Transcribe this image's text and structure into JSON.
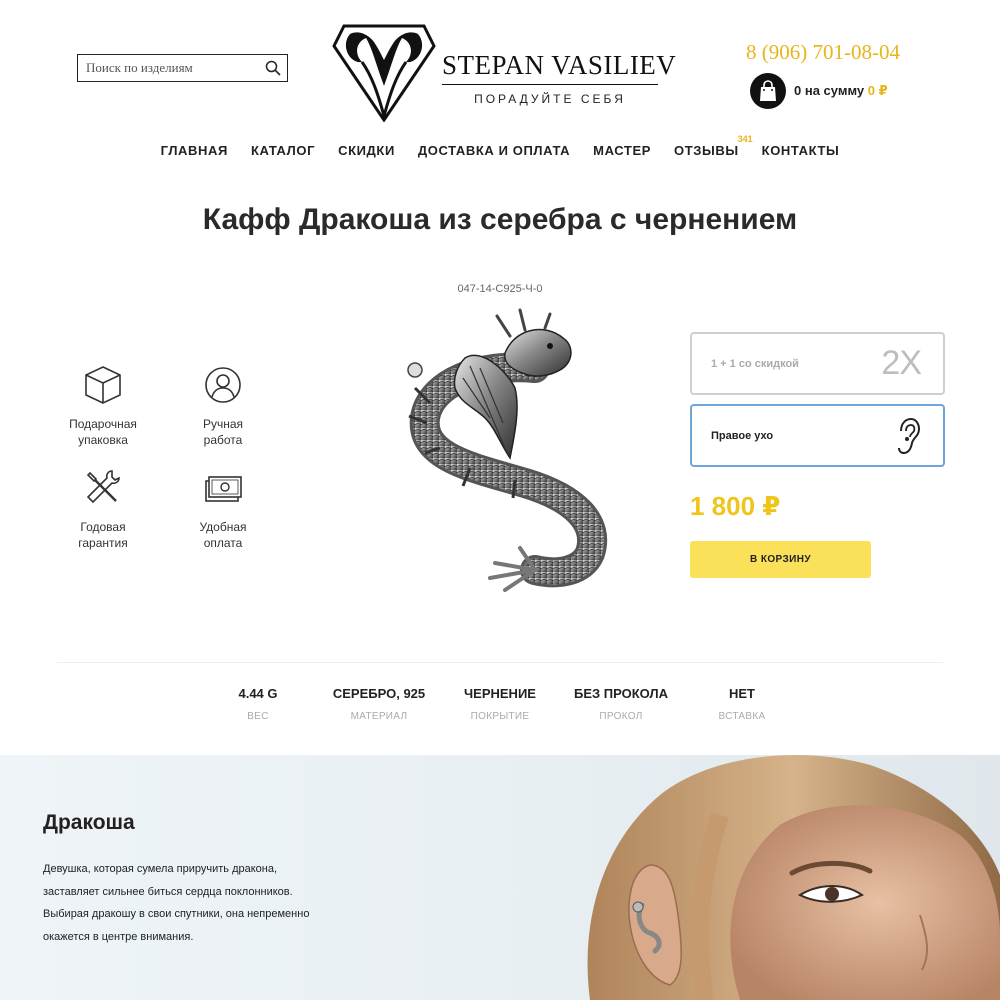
{
  "header": {
    "search_placeholder": "Поиск по изделиям",
    "brand_name": "STEPAN VASILIEV",
    "tagline": "ПОРАДУЙТЕ СЕБЯ",
    "phone": "8 (906) 701-08-04",
    "cart_count_text": "0 на сумму",
    "cart_sum": "0 ₽"
  },
  "nav": {
    "items": [
      "ГЛАВНАЯ",
      "КАТАЛОГ",
      "СКИДКИ",
      "ДОСТАВКА И ОПЛАТА",
      "МАСТЕР",
      "ОТЗЫВЫ",
      "КОНТАКТЫ"
    ],
    "reviews_badge": "341"
  },
  "product": {
    "title": "Кафф Дракоша из серебра с чернением",
    "sku": "047-14-С925-Ч-0",
    "price": "1 800 ₽",
    "buy_label": "В КОРЗИНУ",
    "options": [
      {
        "label": "1 + 1 со скидкой",
        "mark": "2X",
        "selected": false
      },
      {
        "label": "Правое ухо",
        "mark": "ear-icon",
        "selected": true
      }
    ]
  },
  "features": [
    {
      "line1": "Подарочная",
      "line2": "упаковка",
      "icon": "box-icon"
    },
    {
      "line1": "Ручная",
      "line2": "работа",
      "icon": "person-icon"
    },
    {
      "line1": "Годовая",
      "line2": "гарантия",
      "icon": "tools-icon"
    },
    {
      "line1": "Удобная",
      "line2": "оплата",
      "icon": "money-icon"
    }
  ],
  "specs": [
    {
      "value": "4.44 G",
      "label": "ВЕС"
    },
    {
      "value": "СЕРЕБРО, 925",
      "label": "МАТЕРИАЛ"
    },
    {
      "value": "ЧЕРНЕНИЕ",
      "label": "ПОКРЫТИЕ"
    },
    {
      "value": "БЕЗ ПРОКОЛА",
      "label": "ПРОКОЛ"
    },
    {
      "value": "НЕТ",
      "label": "ВСТАВКА"
    }
  ],
  "story": {
    "title": "Дракоша",
    "lines": [
      "Девушка, которая сумела приручить дракона,",
      "заставляет сильнее биться сердца поклонников.",
      "Выбирая дракошу в свои спутники, она непременно",
      "окажется в центре внимания."
    ]
  },
  "colors": {
    "accent_yellow": "#f0c419",
    "button_yellow": "#fbe15a",
    "selected_border": "#6fa6d9"
  }
}
